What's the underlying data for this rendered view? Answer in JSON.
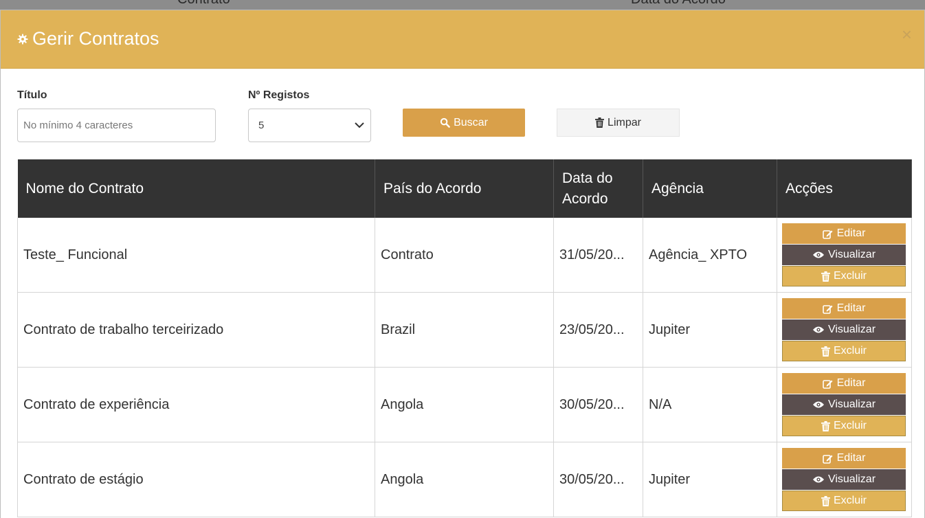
{
  "backdrop": {
    "col1": "Contrato",
    "col2": "Data do Acordo"
  },
  "modal": {
    "title": "Gerir Contratos",
    "close": "×"
  },
  "filters": {
    "title_label": "Título",
    "title_placeholder": "No mínimo 4 caracteres",
    "records_label": "Nº Registos",
    "records_value": "5",
    "search_label": "Buscar",
    "clear_label": "Limpar"
  },
  "table": {
    "headers": [
      "Nome do Contrato",
      "País do Acordo",
      "Data do Acordo",
      "Agência",
      "Acções"
    ],
    "rows": [
      {
        "name": "Teste_ Funcional",
        "country": "Contrato",
        "date": "31/05/20...",
        "agency": "Agência_ XPTO"
      },
      {
        "name": "Contrato de trabalho terceirizado",
        "country": "Brazil",
        "date": "23/05/20...",
        "agency": "Jupiter"
      },
      {
        "name": "Contrato de experiência",
        "country": "Angola",
        "date": "30/05/20...",
        "agency": "N/A"
      },
      {
        "name": "Contrato de estágio",
        "country": "Angola",
        "date": "30/05/20...",
        "agency": "Jupiter"
      }
    ],
    "actions": {
      "edit": "Editar",
      "view": "Visualizar",
      "delete": "Excluir"
    }
  },
  "colors": {
    "header_bg": "#e0b357",
    "primary": "#d9a04a",
    "view_btn": "#5a4e4e",
    "table_head": "#333333"
  }
}
